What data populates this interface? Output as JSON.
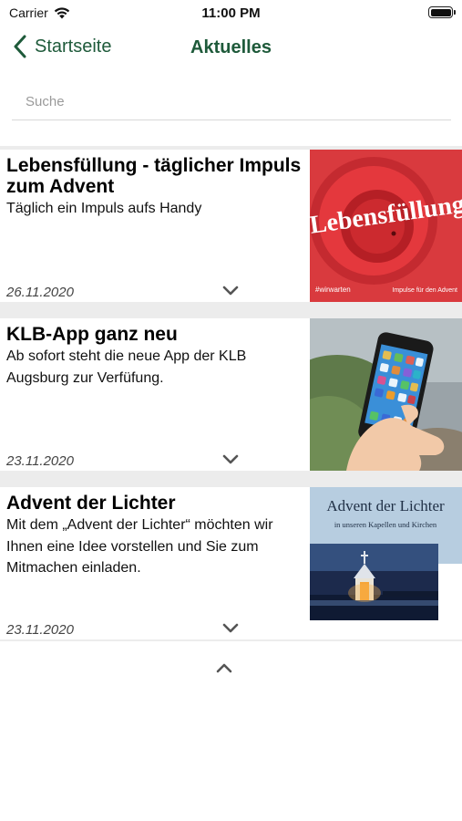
{
  "status_bar": {
    "carrier": "Carrier",
    "time": "11:00 PM"
  },
  "nav": {
    "back_label": "Startseite",
    "title": "Aktuelles"
  },
  "search": {
    "placeholder": "Suche",
    "value": ""
  },
  "colors": {
    "accent": "#1e5a3a",
    "feed_background": "#ececec"
  },
  "news": [
    {
      "title": "Lebensfüllung - täglicher Impuls zum Advent",
      "description": "Täglich ein Impuls aufs Handy",
      "date": "26.11.2020",
      "image": {
        "icon": "red-cup-image",
        "overlay_title": "Lebensfüllung",
        "tag": "#wirwarten",
        "caption": "Impulse für den Advent"
      }
    },
    {
      "title": "KLB-App ganz neu",
      "description": "Ab sofort steht die neue App der KLB Augsburg zur Verfüfung.",
      "date": "23.11.2020",
      "image": {
        "icon": "hand-holding-smartphone-image"
      }
    },
    {
      "title": "Advent der Lichter",
      "description": "Mit dem „Advent der Lichter“ möchten wir Ihnen eine Idee vorstellen und Sie zum Mitmachen einladen.",
      "date": "23.11.2020",
      "image": {
        "icon": "chapel-at-night-image",
        "overlay_title": "Advent der Lichter",
        "subtitle": "in unseren Kapellen und Kirchen"
      }
    }
  ]
}
